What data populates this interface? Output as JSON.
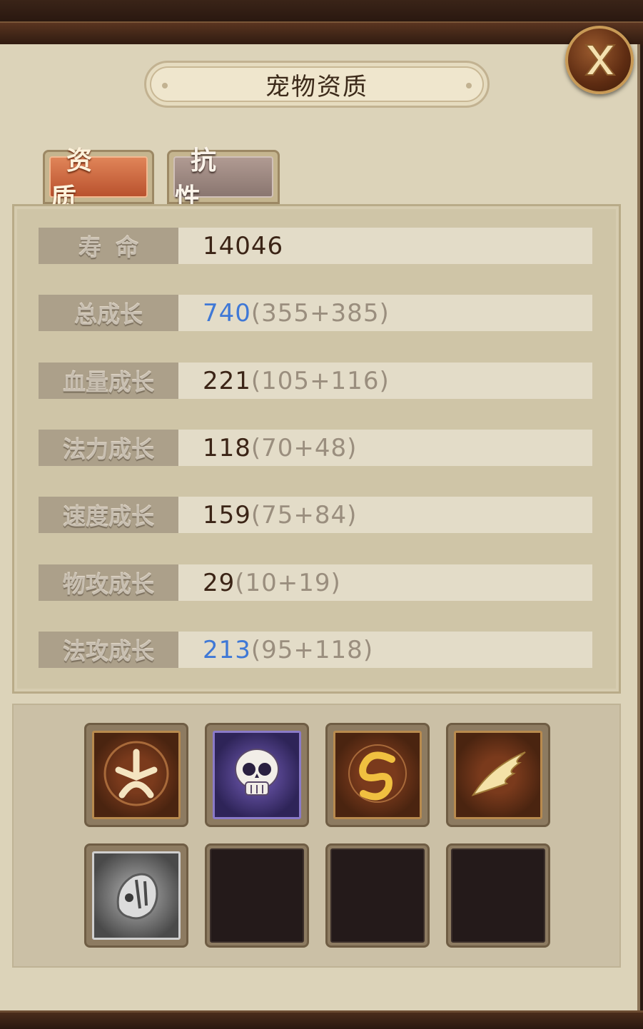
{
  "window": {
    "title": "宠物资质"
  },
  "tabs": [
    {
      "label": "资质",
      "active": true
    },
    {
      "label": "抗性",
      "active": false
    }
  ],
  "stats": [
    {
      "label": "寿命",
      "value": "14046",
      "detail": "",
      "highlight": false
    },
    {
      "label": "总成长",
      "value": "740",
      "detail": "(355+385)",
      "highlight": true
    },
    {
      "label": "血量成长",
      "value": "221",
      "detail": "(105+116)",
      "highlight": false
    },
    {
      "label": "法力成长",
      "value": "118",
      "detail": "(70+48)",
      "highlight": false
    },
    {
      "label": "速度成长",
      "value": "159",
      "detail": "(75+84)",
      "highlight": false
    },
    {
      "label": "物攻成长",
      "value": "29",
      "detail": "(10+19)",
      "highlight": false
    },
    {
      "label": "法攻成长",
      "value": "213",
      "detail": "(95+118)",
      "highlight": true
    }
  ],
  "skills": [
    {
      "icon": "star-rune-icon",
      "style": "bronze"
    },
    {
      "icon": "skull-icon",
      "style": "purple"
    },
    {
      "icon": "swirl-icon",
      "style": "bronze"
    },
    {
      "icon": "wing-icon",
      "style": "bronze"
    },
    {
      "icon": "beast-head-icon",
      "style": "silver"
    },
    {
      "icon": "",
      "style": "empty"
    },
    {
      "icon": "",
      "style": "empty"
    },
    {
      "icon": "",
      "style": "empty"
    }
  ],
  "colors": {
    "highlight_value": "#3f78d6",
    "normal_value": "#3b2416",
    "detail": "#9a8e7e",
    "active_tab": "#c9653a"
  }
}
